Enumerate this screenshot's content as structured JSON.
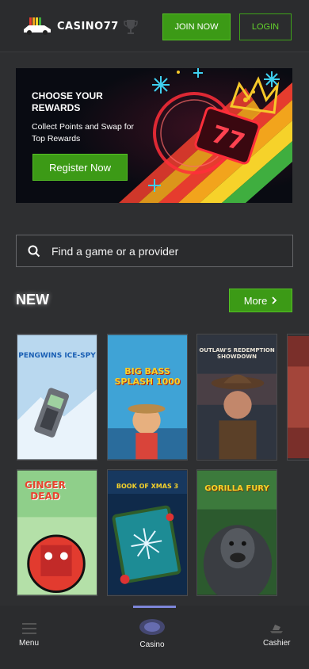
{
  "header": {
    "logo_text": "CASINO77",
    "join_label": "JOIN NOW",
    "login_label": "LOGIN",
    "icons": [
      "car-logo-icon",
      "trophy-icon"
    ]
  },
  "banner": {
    "title": "CHOOSE YOUR REWARDS",
    "subtitle": "Collect Points and Swap for Top Rewards",
    "button": "Register Now",
    "reel_text": "77"
  },
  "search": {
    "placeholder": "Find a game or a provider",
    "icon": "search-icon"
  },
  "new_section": {
    "title": "NEW",
    "more_label": "More",
    "games": [
      {
        "title": "PENGWINS ICE-SPY"
      },
      {
        "title": "BIG BASS SPLASH 1000"
      },
      {
        "title": "OUTLAW'S REDEMPTION SHOWDOWN"
      },
      {
        "title": "GINGER DEAD"
      },
      {
        "title": "BOOK OF XMAS 3"
      },
      {
        "title": "GORILLA FURY"
      }
    ]
  },
  "bottom_nav": {
    "menu": "Menu",
    "casino": "Casino",
    "cashier": "Cashier"
  },
  "colors": {
    "accent_green": "#3c9a16",
    "background": "#2e2f31",
    "nav_indicator": "#7d86d9"
  }
}
